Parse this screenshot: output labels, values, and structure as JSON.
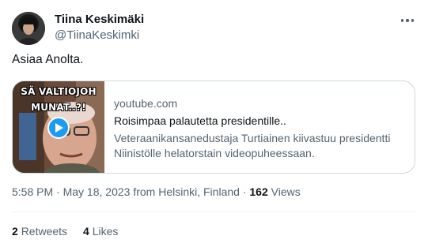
{
  "author": {
    "name": "Tiina Keskimäki",
    "handle": "@TiinaKeskimki"
  },
  "tweet": {
    "text": "Asiaa Anolta."
  },
  "card": {
    "thumbnail_line1": "SÄ VALTIOJOH",
    "thumbnail_line2": "MUNAT..?!",
    "domain": "youtube.com",
    "title": "Roisimpaa palautetta presidentille..",
    "description_line1": "Veteraanikansanedustaja Turtiainen kiivastuu presidentti",
    "description_line2": "Niinistölle helatorstain videopuheessaan."
  },
  "meta": {
    "time": "5:58 PM",
    "separator1": " · ",
    "date": "May 18, 2023",
    "location": " from Helsinki, Finland",
    "separator2": " · ",
    "views_count": "162",
    "views_label": " Views"
  },
  "stats": {
    "retweets_count": "2",
    "retweets_label": "Retweets",
    "likes_count": "4",
    "likes_label": "Likes"
  },
  "colors": {
    "primary_text": "#0f1419",
    "secondary_text": "#536471",
    "border": "#cfd9de",
    "play_button": "#1d9bf0"
  },
  "icons": {
    "more": "more-horizontal-icon",
    "play": "play-icon"
  }
}
